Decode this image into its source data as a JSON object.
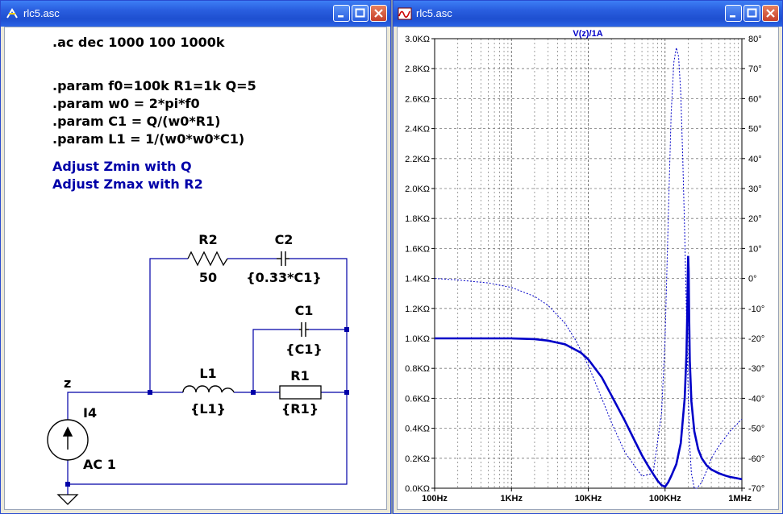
{
  "windows": {
    "left": {
      "title": "rlc5.asc"
    },
    "right": {
      "title": "rlc5.asc"
    }
  },
  "schematic": {
    "directives": [
      ".ac dec 1000 100 1000k",
      ".param f0=100k  R1=1k Q=5",
      ".param w0 = 2*pi*f0",
      ".param C1 = Q/(w0*R1)",
      ".param L1 = 1/(w0*w0*C1)"
    ],
    "comments": [
      "Adjust Zmin with Q",
      "Adjust Zmax with R2"
    ],
    "components": {
      "r2": {
        "name": "R2",
        "value": "50"
      },
      "c2": {
        "name": "C2",
        "value": "{0.33*C1}"
      },
      "c1": {
        "name": "C1",
        "value": "{C1}"
      },
      "l1": {
        "name": "L1",
        "value": "{L1}"
      },
      "r1": {
        "name": "R1",
        "value": "{R1}"
      },
      "i4": {
        "name": "I4",
        "value": "AC 1"
      }
    },
    "net_label": "z",
    "colors": {
      "wire": "#0000a8",
      "comment": "#0000a8",
      "text": "#000000"
    }
  },
  "plot": {
    "trace_label": "V(z)/1A",
    "trace_color": "#0000c8",
    "x_ticks": [
      "100Hz",
      "1KHz",
      "10KHz",
      "100KHz",
      "1MHz"
    ],
    "left_ticks": [
      "3.0KΩ",
      "2.8KΩ",
      "2.6KΩ",
      "2.4KΩ",
      "2.2KΩ",
      "2.0KΩ",
      "1.8KΩ",
      "1.6KΩ",
      "1.4KΩ",
      "1.2KΩ",
      "1.0KΩ",
      "0.8KΩ",
      "0.6KΩ",
      "0.4KΩ",
      "0.2KΩ",
      "0.0KΩ"
    ],
    "right_ticks": [
      "80°",
      "70°",
      "60°",
      "50°",
      "40°",
      "30°",
      "20°",
      "10°",
      "0°",
      "-10°",
      "-20°",
      "-30°",
      "-40°",
      "-50°",
      "-60°",
      "-70°"
    ]
  },
  "chart_data": {
    "type": "line",
    "title": "V(z)/1A",
    "x_scale": "log",
    "xlim": [
      100,
      1000000
    ],
    "ylim_left": [
      0,
      3000
    ],
    "ylim_right": [
      -70,
      80
    ],
    "grid": true,
    "series": [
      {
        "name": "V(z)/1A",
        "axis": "left",
        "style": "solid",
        "x": [
          100,
          200,
          500,
          1000,
          2000,
          3000,
          5000,
          8000,
          10000,
          15000,
          20000,
          30000,
          40000,
          50000,
          60000,
          70000,
          80000,
          90000,
          100000,
          110000,
          120000,
          140000,
          160000,
          180000,
          190000,
          195000,
          198000,
          200000,
          203000,
          206000,
          210000,
          220000,
          240000,
          270000,
          300000,
          350000,
          400000,
          500000,
          600000,
          700000,
          800000,
          1000000
        ],
        "y": [
          1000,
          1000,
          1000,
          1000,
          995,
          985,
          960,
          905,
          860,
          740,
          620,
          450,
          320,
          220,
          150,
          95,
          50,
          20,
          10,
          40,
          80,
          160,
          300,
          600,
          900,
          1200,
          1450,
          1550,
          1450,
          1150,
          850,
          580,
          380,
          260,
          200,
          150,
          125,
          100,
          85,
          75,
          70,
          60
        ]
      },
      {
        "name": "",
        "axis": "right",
        "style": "dotted",
        "x": [
          100,
          200,
          500,
          1000,
          2000,
          3000,
          5000,
          7000,
          10000,
          15000,
          20000,
          30000,
          50000,
          70000,
          90000,
          100000,
          110000,
          120000,
          130000,
          140000,
          150000,
          160000,
          170000,
          180000,
          190000,
          200000,
          210000,
          220000,
          240000,
          260000,
          300000,
          350000,
          400000,
          500000,
          700000,
          1000000
        ],
        "y": [
          0,
          -0.5,
          -1.5,
          -3,
          -6,
          -9,
          -15,
          -21,
          -29,
          -40,
          -48,
          -58,
          -66,
          -65,
          -45,
          -20,
          20,
          55,
          72,
          77,
          74,
          62,
          40,
          15,
          -12,
          -38,
          -56,
          -65,
          -70,
          -70,
          -68,
          -64,
          -60,
          -56,
          -51,
          -47
        ]
      }
    ]
  }
}
